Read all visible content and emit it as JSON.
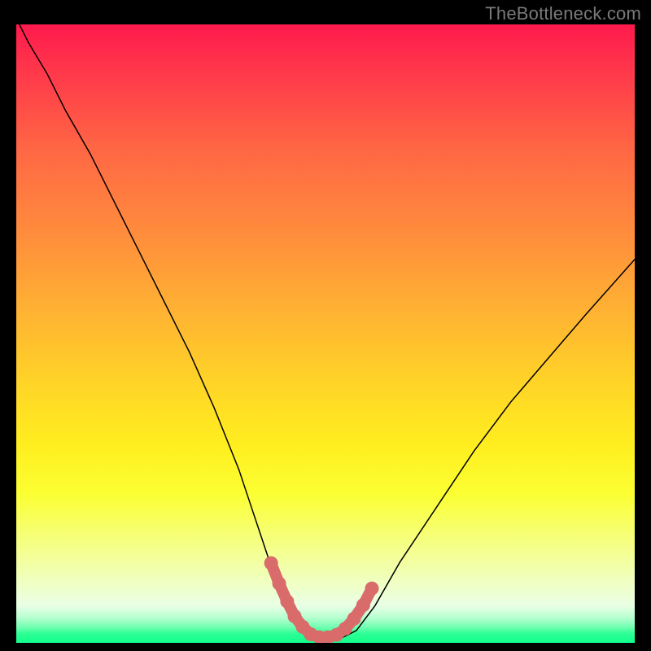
{
  "watermark": {
    "text": "TheBottleneck.com"
  },
  "colors": {
    "background": "#000000",
    "curve": "#000000",
    "marker": "#d96b6b",
    "gradient_top": "#ff1a4d",
    "gradient_mid1": "#ff8a3d",
    "gradient_mid2": "#ffee1f",
    "gradient_bottom": "#11ff8c"
  },
  "chart_data": {
    "type": "line",
    "title": "",
    "xlabel": "",
    "ylabel": "",
    "xlim": [
      0,
      100
    ],
    "ylim": [
      0,
      100
    ],
    "grid": false,
    "legend": false,
    "x": [
      0,
      2,
      5,
      8,
      12,
      16,
      20,
      24,
      28,
      32,
      36,
      38,
      40,
      42,
      44,
      45,
      46,
      48,
      50,
      52,
      53,
      55,
      58,
      62,
      68,
      74,
      80,
      86,
      92,
      96,
      100
    ],
    "values": [
      101,
      97,
      92,
      86,
      79,
      71,
      63,
      55,
      47,
      38,
      28,
      22,
      16,
      10,
      6,
      3.5,
      2,
      1,
      0.6,
      0.6,
      1,
      2,
      6,
      13,
      22,
      31,
      39,
      46,
      53,
      57.5,
      62
    ],
    "note": "x/y in 0–100; y is distance from bottom of plot (approx shape of a bottleneck V-curve with a flat minimum near x≈48–52)",
    "marker_segment": {
      "points": [
        {
          "x": 41.2,
          "y": 12.9
        },
        {
          "x": 42.5,
          "y": 9.6
        },
        {
          "x": 43.8,
          "y": 6.7
        },
        {
          "x": 45.0,
          "y": 4.3
        },
        {
          "x": 46.3,
          "y": 2.6
        },
        {
          "x": 47.6,
          "y": 1.4
        },
        {
          "x": 49.0,
          "y": 0.9
        },
        {
          "x": 50.4,
          "y": 0.9
        },
        {
          "x": 51.8,
          "y": 1.3
        },
        {
          "x": 53.2,
          "y": 2.3
        },
        {
          "x": 54.6,
          "y": 3.9
        },
        {
          "x": 56.1,
          "y": 6.1
        },
        {
          "x": 57.5,
          "y": 8.8
        }
      ]
    }
  }
}
